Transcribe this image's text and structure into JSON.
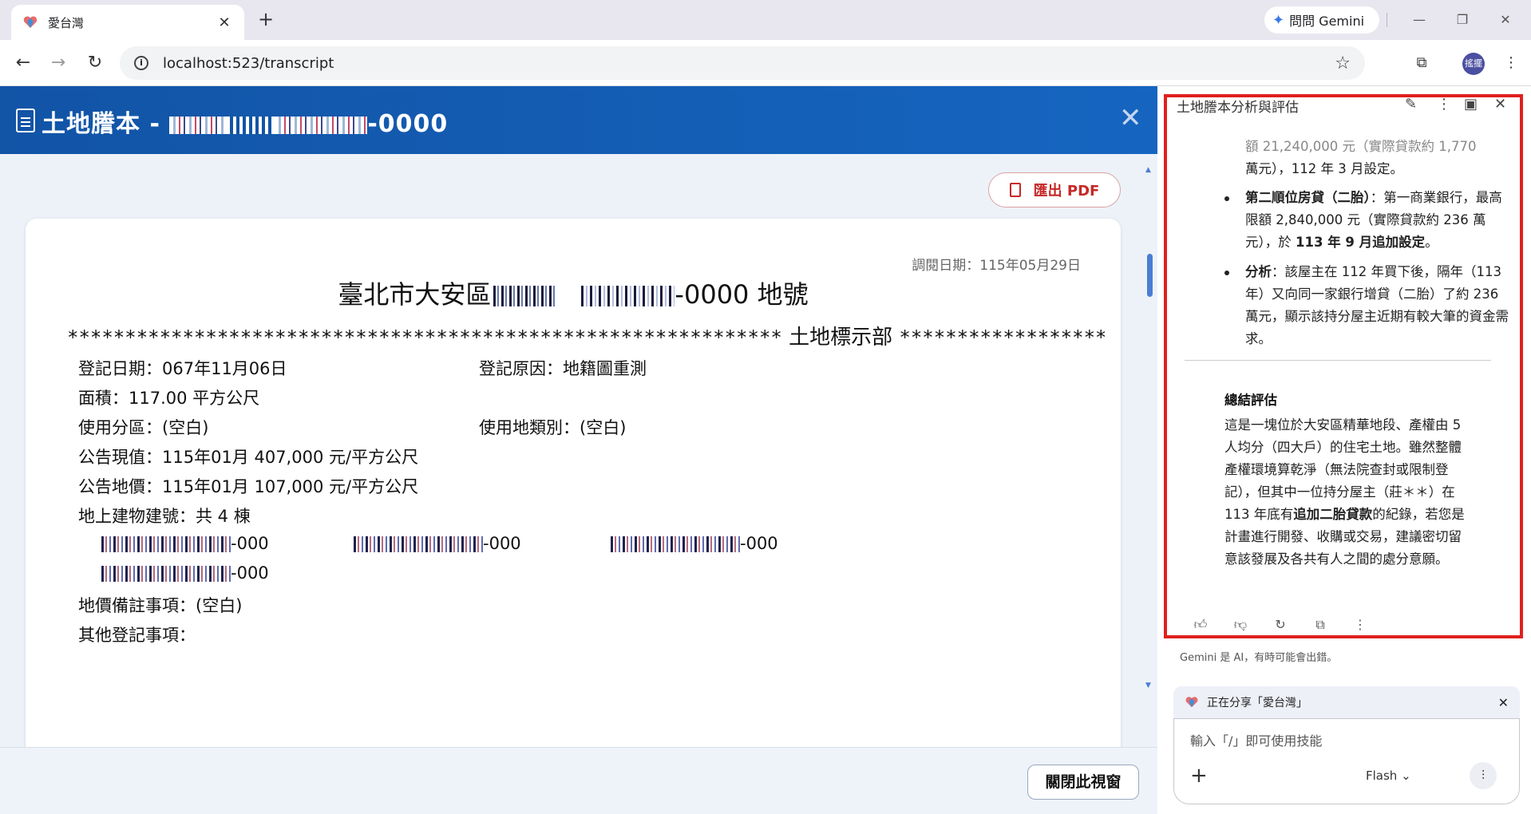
{
  "browser": {
    "tab_title": "愛台灣",
    "tab_close": "✕",
    "new_tab": "+",
    "gemini_button": "問問 Gemini",
    "url": "localhost:523/transcript",
    "avatar_text": "搖擺"
  },
  "page": {
    "header_title_prefix": "土地謄本 - ",
    "header_title_suffix": "-0000",
    "export_pdf": "匯出 PDF",
    "query_date": "調閱日期：115年05月29日",
    "doc_title_prefix": "臺北市大安區",
    "doc_title_suffix": "-0000 地號",
    "stars_left": "**************************************************************",
    "section_title": " 土地標示部 ",
    "stars_right": "*************************************",
    "fields": {
      "reg_date": "登記日期：067年11月06日",
      "reg_reason": "登記原因：地籍圖重測",
      "area": "面積：117.00 平方公尺",
      "zoning": "使用分區：(空白)",
      "land_category": "使用地類別：(空白)",
      "announced_value": "公告現值：115年01月 407,000 元/平方公尺",
      "announced_price": "公告地價：115年01月 107,000 元/平方公尺",
      "buildings": "地上建物建號：共 4 棟",
      "land_note": "地價備註事項：(空白)",
      "other": "其他登記事項："
    },
    "building_suffix_1": "-000",
    "building_suffix_2": "-000",
    "building_suffix_3": "-000",
    "building_suffix_4": "-000",
    "close_window": "關閉此視窗"
  },
  "sidebar": {
    "title": "土地謄本分析與評估",
    "partial_top_1": "額 21,240,000 元（實際貸款約 1,770",
    "partial_top_2": "萬元），112 年 3 月設定。",
    "bullet1_bold": "第二順位房貸（二胎）",
    "bullet1_text": "：第一商業銀行，最高限額 2,840,000 元（實際貸款約 236 萬元），於 ",
    "bullet1_bold2": "113 年 9 月追加設定",
    "bullet1_end": "。",
    "bullet2_bold": "分析",
    "bullet2_text": "：該屋主在 112 年買下後，隔年（113年）又向同一家銀行增貸（二胎）了約 236 萬元，顯示該持分屋主近期有較大筆的資金需求。",
    "summary_title": "總結評估",
    "summary_1": "這是一塊位於大安區精華地段、產權由 5 人均分（四大戶）的住宅土地。雖然整體產權環境算乾淨（無法院查封或限制登記），但其中一位持分屋主（莊＊＊）在 113 年底有",
    "summary_bold": "追加二胎貸款",
    "summary_2": "的紀錄，若您是計畫進行開發、收購或交易，建議密切留意該發展及各共有人之間的處分意願。",
    "disclaimer": "Gemini 是 AI，有時可能會出錯。",
    "sharing": "正在分享「愛台灣」",
    "input_placeholder": "輸入「/」即可使用技能",
    "model": "Flash"
  }
}
